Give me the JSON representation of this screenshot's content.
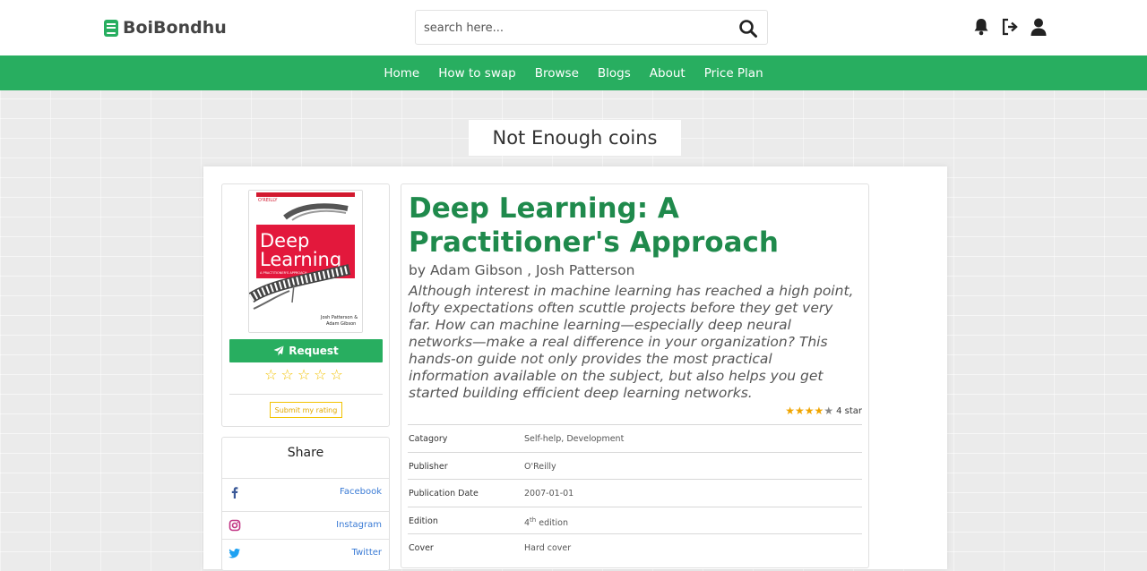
{
  "brand": {
    "name": "BoiBondhu"
  },
  "search": {
    "placeholder": "search here..."
  },
  "nav": {
    "items": [
      "Home",
      "How to swap",
      "Browse",
      "Blogs",
      "About",
      "Price Plan"
    ]
  },
  "alert": {
    "text": "Not Enough coins"
  },
  "book": {
    "cover": {
      "publisher_mark": "O'REILLY",
      "title_line1": "Deep",
      "title_line2": "Learning",
      "subtitle": "A PRACTITIONER'S APPROACH",
      "authors_line1": "Josh Patterson &",
      "authors_line2": "Adam Gibson"
    },
    "title": "Deep Learning: A Practitioner's Approach",
    "author": "by Adam Gibson , Josh Patterson",
    "description": "Although interest in machine learning has reached a high point, lofty expectations often scuttle projects before they get very far. How can machine learning—especially deep neural networks—make a real difference in your organization? This hands-on guide not only provides the most practical information available on the subject, but also helps you get started building efficient deep learning networks.",
    "rating": 4,
    "rating_text": "4 star",
    "details": {
      "category_label": "Catagory",
      "category": "Self-help, Development",
      "publisher_label": "Publisher",
      "publisher": "O'Reilly",
      "date_label": "Publication Date",
      "date": "2007-01-01",
      "edition_label": "Edition",
      "edition_num": "4",
      "edition_sup": "th",
      "edition_word": " edition",
      "cover_label": "Cover",
      "cover": "Hard cover"
    }
  },
  "actions": {
    "request_label": "Request",
    "submit_rating_label": "Submit my rating",
    "user_rating_max": 5
  },
  "share": {
    "title": "Share",
    "items": [
      {
        "label": "Facebook",
        "icon": "facebook-icon",
        "color": "#3b5998"
      },
      {
        "label": "Instagram",
        "icon": "instagram-icon",
        "color": "#c13584"
      },
      {
        "label": "Twitter",
        "icon": "twitter-icon",
        "color": "#1da1f2"
      }
    ]
  },
  "colors": {
    "brand_green": "#28ae60",
    "title_green": "#1f8a4c",
    "star_yellow": "#f2c200"
  }
}
